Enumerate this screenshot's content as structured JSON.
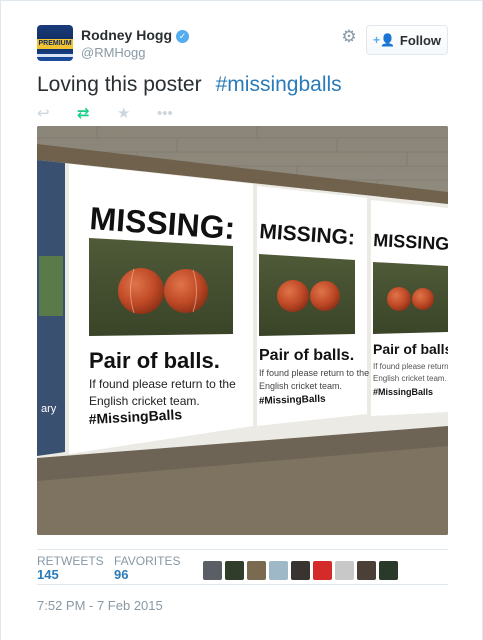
{
  "author": {
    "name": "Rodney Hogg",
    "handle": "@RMHogg",
    "avatar_text": "PREMIUM",
    "verified_icon": "verified-check-icon"
  },
  "header": {
    "settings_icon": "gear-icon",
    "follow_label": "Follow",
    "follow_icon": "add-user-icon"
  },
  "tweet": {
    "text": "Loving this poster",
    "hashtag": "#missingballs"
  },
  "actions": {
    "reply_icon": "reply-icon",
    "retweet_icon": "retweet-icon",
    "favorite_icon": "star-icon",
    "more_icon": "more-icon"
  },
  "poster": {
    "headline": "MISSING:",
    "subhead": "Pair of balls.",
    "line1": "If found please return to the",
    "line2": "English cricket team.",
    "tag": "#MissingBalls",
    "left_fragment": "ary"
  },
  "stats": {
    "retweets_label": "RETWEETS",
    "retweets_count": "145",
    "favorites_label": "FAVORITES",
    "favorites_count": "96",
    "favoriter_colors": [
      "#5a5f66",
      "#2f3d2a",
      "#7a6a50",
      "#9fb8c8",
      "#3a3430",
      "#d42a2a",
      "#c8c8c8",
      "#4a4038",
      "#2a3a2a"
    ]
  },
  "timestamp": "7:52 PM - 7 Feb 2015"
}
